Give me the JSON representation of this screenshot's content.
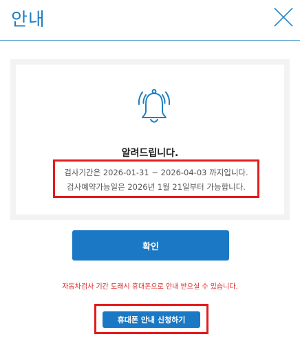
{
  "header": {
    "title": "안내",
    "accent_color": "#1f7fc2"
  },
  "notice": {
    "icon": "bell-icon",
    "title": "알려드립니다.",
    "period_line": "검사기간은 2026-01-31 ~ 2026-04-03 까지입니다.",
    "available_line": "검사예약가능일은 2026년 1월 21일부터 가능합니다."
  },
  "buttons": {
    "confirm_label": "확인",
    "sms_label": "휴대폰 안내 신청하기",
    "button_color": "#1a78c4"
  },
  "sms_info": "자동차검사 기간 도래시 휴대폰으로 안내 받으실 수 있습니다.",
  "highlight_color": "#e31b1b"
}
